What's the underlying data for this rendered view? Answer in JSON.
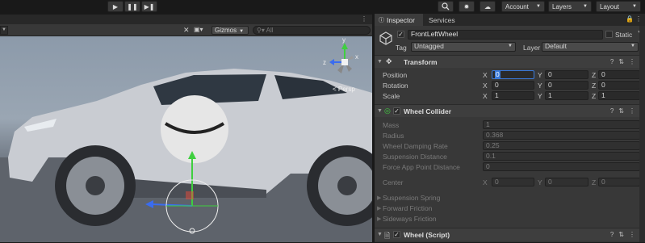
{
  "toolbar": {
    "play_icon": "play-icon",
    "pause_icon": "pause-icon",
    "step_icon": "step-icon",
    "account_label": "Account",
    "layers_label": "Layers",
    "layout_label": "Layout"
  },
  "scene": {
    "gizmos_label": "Gizmos",
    "search_placeholder": "All",
    "persp_label": "< Persp",
    "axis_x": "x",
    "axis_y": "y",
    "axis_z": "z"
  },
  "inspector": {
    "tabs": [
      {
        "label": "Inspector"
      },
      {
        "label": "Services"
      }
    ],
    "object": {
      "name": "FrontLeftWheel",
      "static_label": "Static",
      "tag_label": "Tag",
      "tag_value": "Untagged",
      "layer_label": "Layer",
      "layer_value": "Default"
    },
    "transform": {
      "title": "Transform",
      "rows": [
        {
          "label": "Position",
          "x": "0",
          "y": "0",
          "z": "0"
        },
        {
          "label": "Rotation",
          "x": "0",
          "y": "0",
          "z": "0"
        },
        {
          "label": "Scale",
          "x": "1",
          "y": "1",
          "z": "1"
        }
      ]
    },
    "wheel_collider": {
      "title": "Wheel Collider",
      "fields": [
        {
          "label": "Mass",
          "value": "1"
        },
        {
          "label": "Radius",
          "value": "0.368"
        },
        {
          "label": "Wheel Damping Rate",
          "value": "0.25"
        },
        {
          "label": "Suspension Distance",
          "value": "0.1"
        },
        {
          "label": "Force App Point Distance",
          "value": "0"
        }
      ],
      "center": {
        "label": "Center",
        "x": "0",
        "y": "0",
        "z": "0"
      },
      "foldouts": [
        "Suspension Spring",
        "Forward Friction",
        "Sideways Friction"
      ]
    },
    "wheel_script": {
      "title": "Wheel (Script)"
    }
  },
  "colors": {
    "accent_green": "#3fcf3f",
    "axis_red": "#e84a3a",
    "axis_blue": "#3a6cf0",
    "car_body": "#c9ccd2"
  }
}
